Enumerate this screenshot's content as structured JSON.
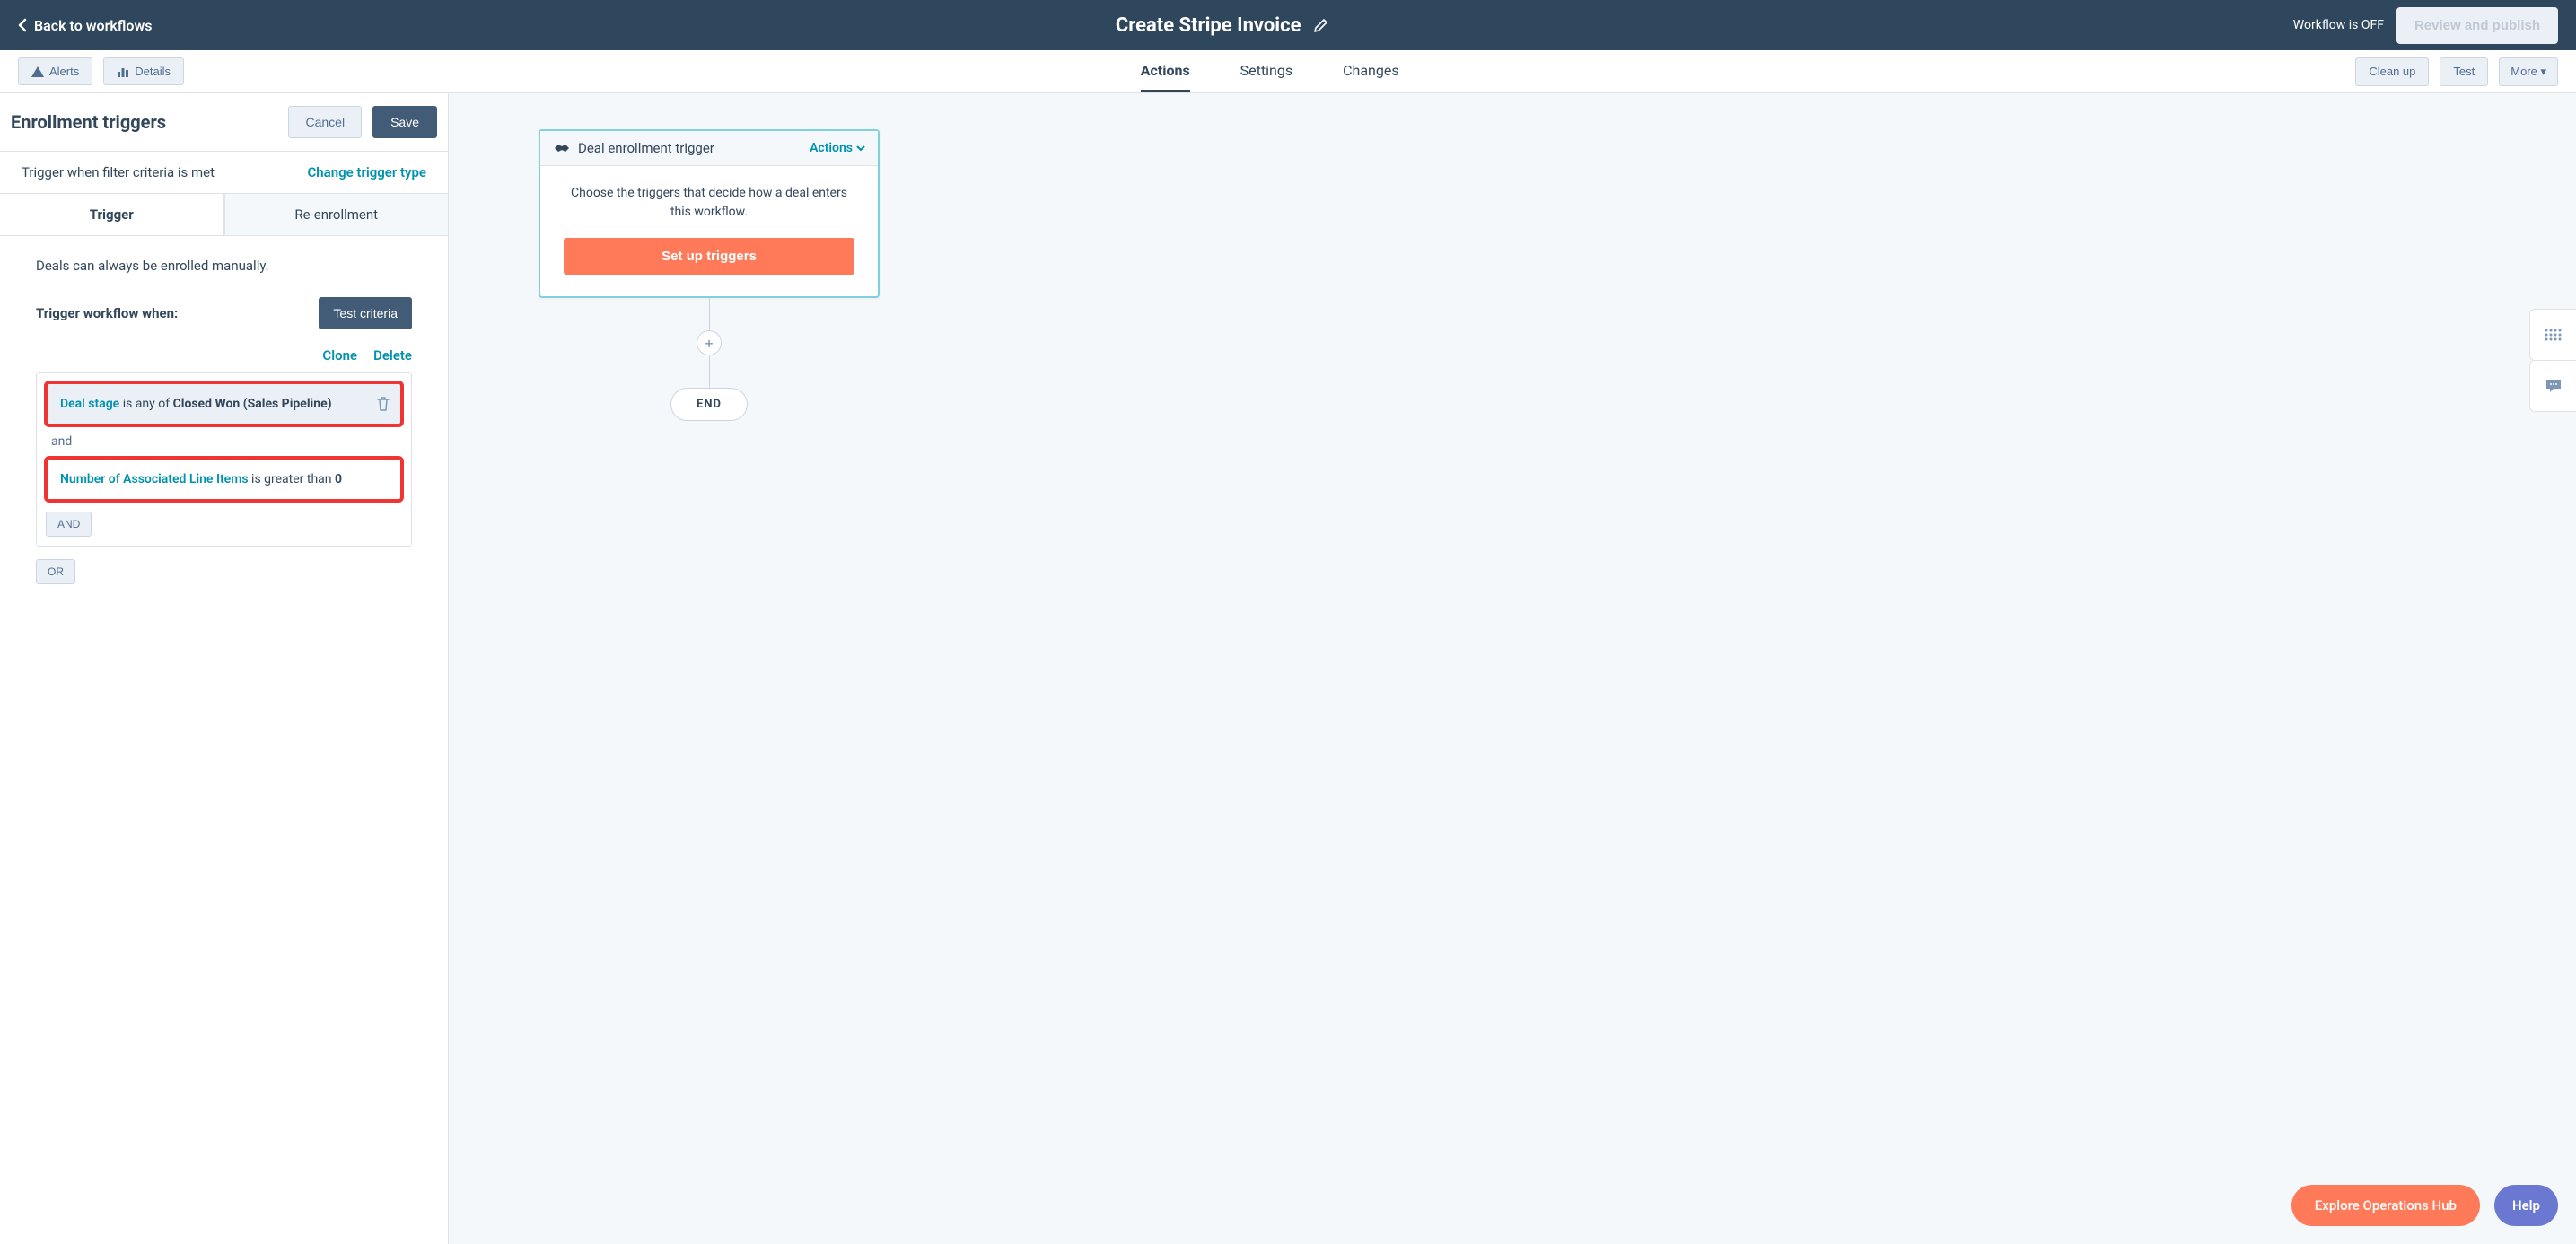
{
  "topbar": {
    "back_label": "Back to workflows",
    "title": "Create Stripe Invoice",
    "status": "Workflow is OFF",
    "review_label": "Review and publish"
  },
  "subbar": {
    "alerts": "Alerts",
    "details": "Details",
    "tabs": {
      "actions": "Actions",
      "settings": "Settings",
      "changes": "Changes"
    },
    "cleanup": "Clean up",
    "test": "Test",
    "more": "More"
  },
  "sidebar": {
    "title": "Enrollment triggers",
    "cancel": "Cancel",
    "save": "Save",
    "trigger_desc": "Trigger when filter criteria is met",
    "change_link": "Change trigger type",
    "tabs": {
      "trigger": "Trigger",
      "reenrollment": "Re-enrollment"
    },
    "note": "Deals can always be enrolled manually.",
    "when_label": "Trigger workflow when:",
    "test_criteria": "Test criteria",
    "clone": "Clone",
    "delete": "Delete",
    "criteria": [
      {
        "field": "Deal stage",
        "op": "is any of",
        "value": "Closed Won (Sales Pipeline)"
      },
      {
        "field": "Number of Associated Line Items",
        "op": "is greater than",
        "value": "0"
      }
    ],
    "and_sep": "and",
    "and_btn": "AND",
    "or_btn": "OR"
  },
  "canvas": {
    "card_title": "Deal enrollment trigger",
    "card_actions": "Actions",
    "card_body": "Choose the triggers that decide how a deal enters this workflow.",
    "setup_btn": "Set up triggers",
    "end": "END"
  },
  "bottom": {
    "explore": "Explore Operations Hub",
    "help": "Help"
  }
}
